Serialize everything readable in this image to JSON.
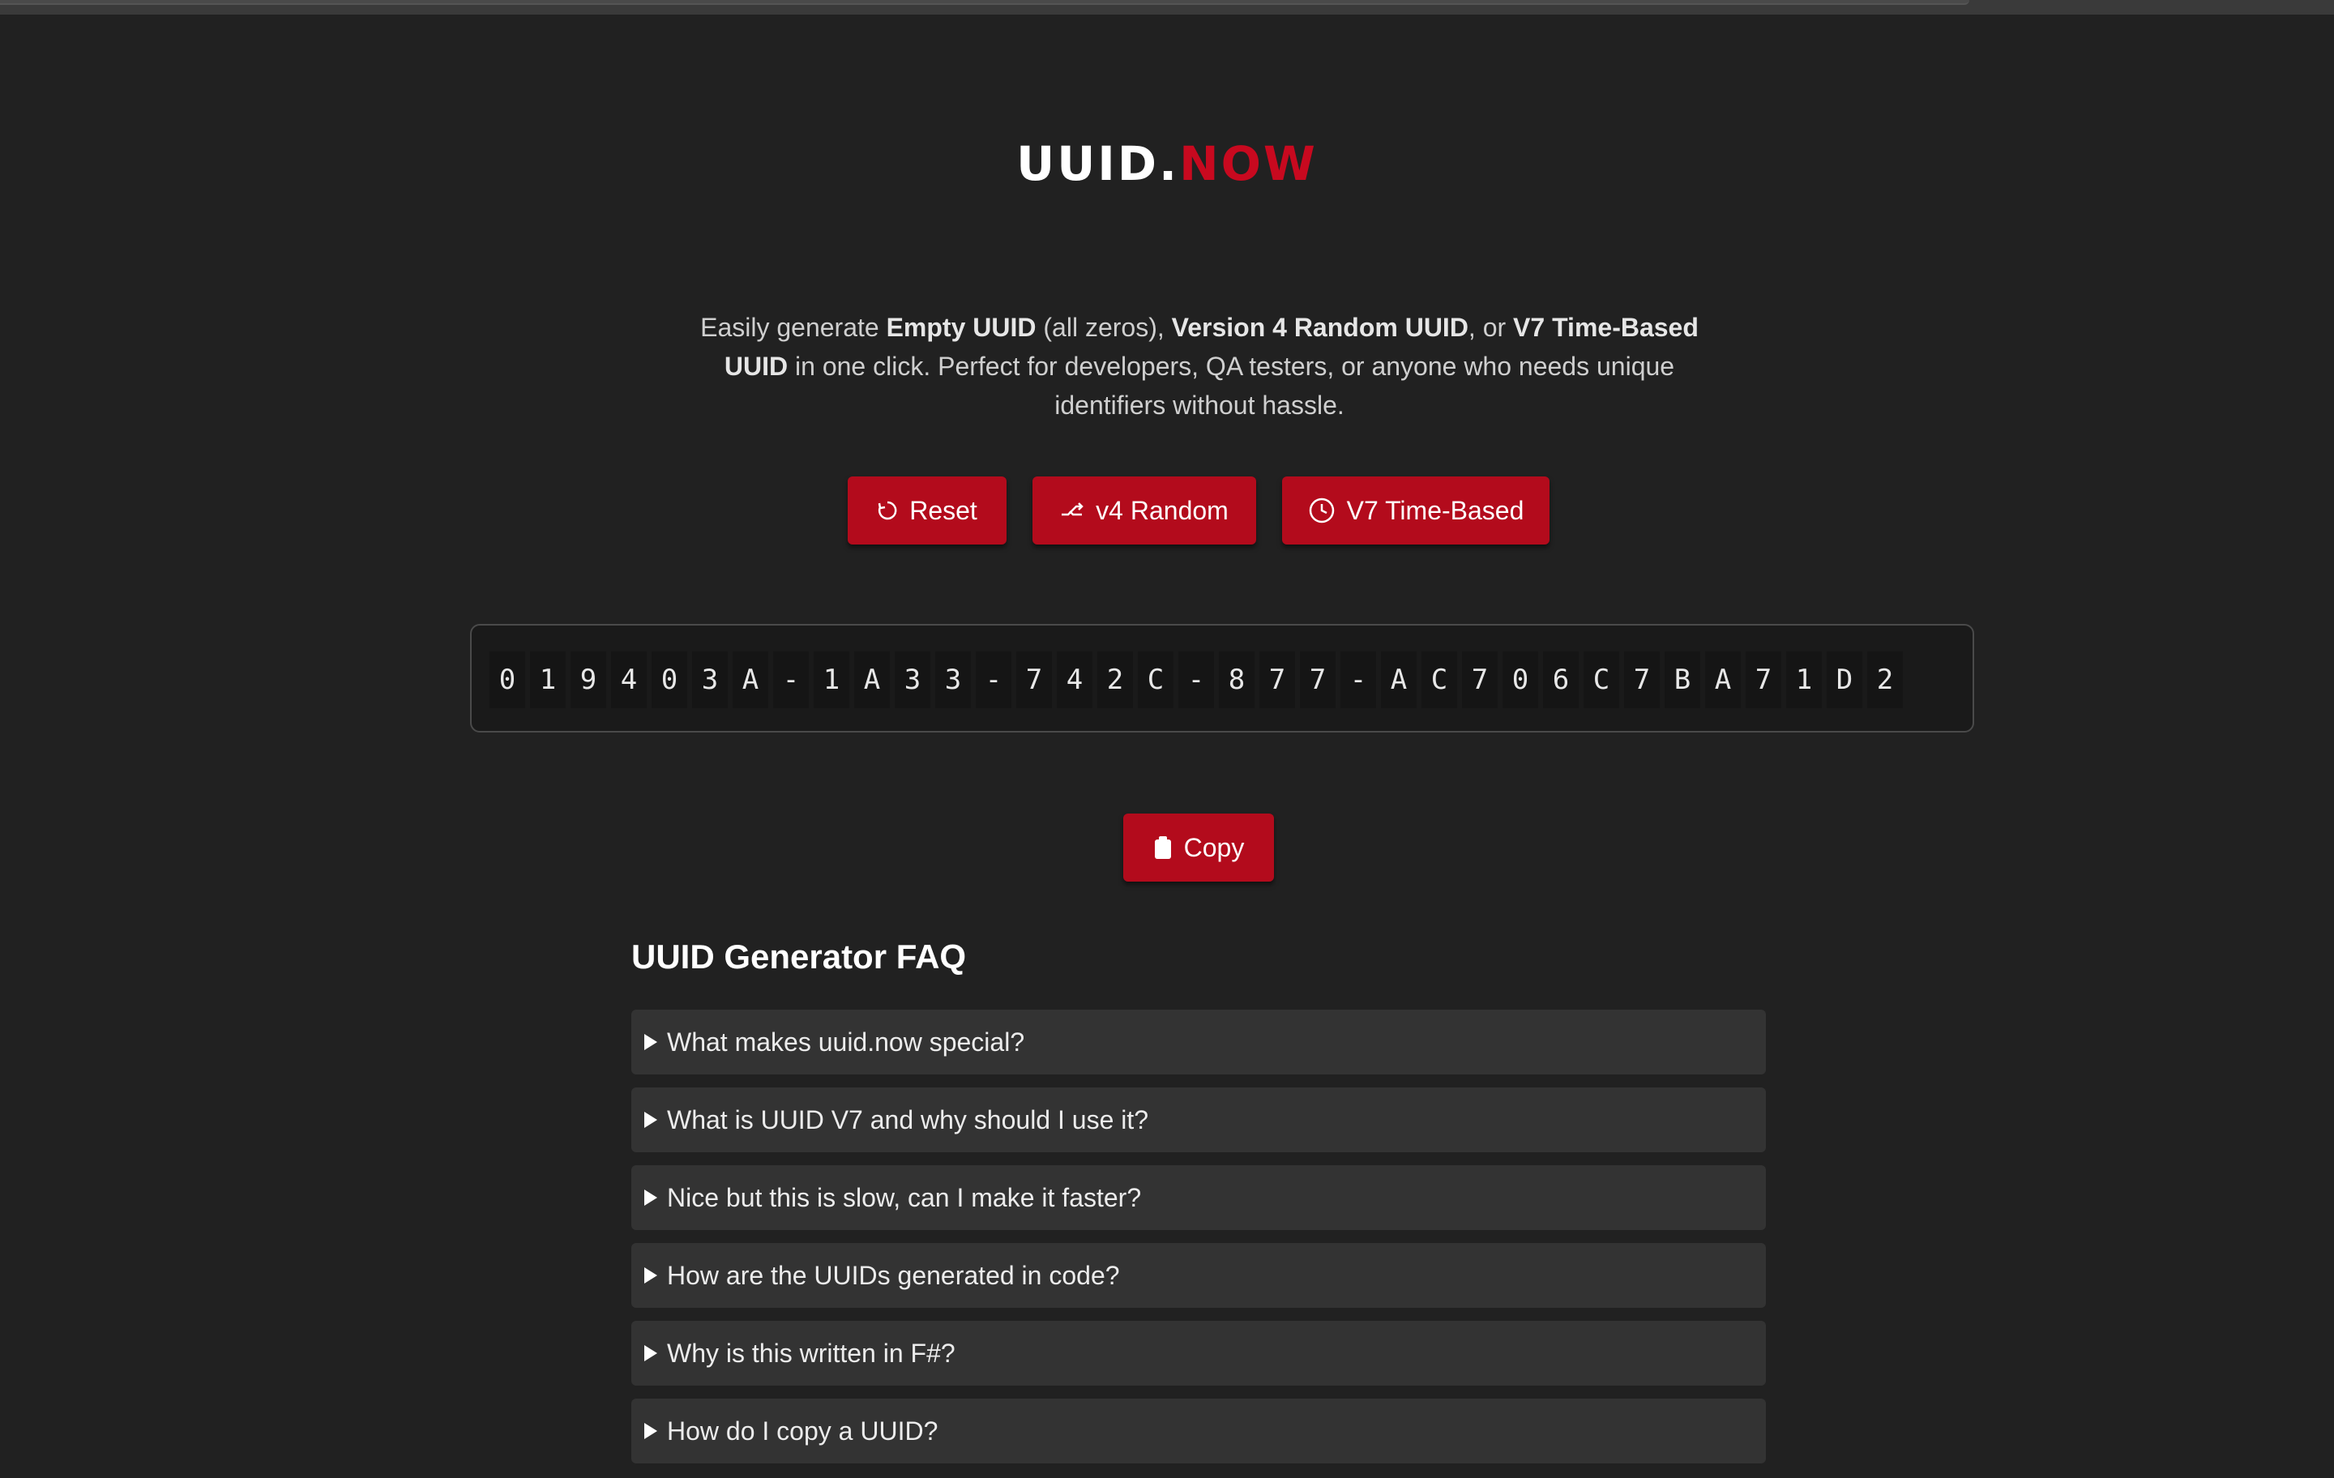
{
  "logo": {
    "part1": "UUID.",
    "part2": "NOW"
  },
  "intro": {
    "t1": "Easily generate ",
    "b1": "Empty UUID",
    "t2": " (all zeros), ",
    "b2": "Version 4 Random UUID",
    "t3": ", or ",
    "b3": "V7 Time-Based UUID",
    "t4": " in one click. Perfect for developers, QA testers, or anyone who needs unique identifiers without hassle."
  },
  "buttons": {
    "reset": "Reset",
    "v4": "v4 Random",
    "v7": "V7 Time-Based",
    "copy": "Copy"
  },
  "uuid": "019403A-1A33-742C-877-AC706C7BA71D2",
  "faq": {
    "title": "UUID Generator FAQ",
    "items": [
      "What makes uuid.now special?",
      "What is UUID V7 and why should I use it?",
      "Nice but this is slow, can I make it faster?",
      "How are the UUIDs generated in code?",
      "Why is this written in F#?",
      "How do I copy a UUID?"
    ]
  },
  "colors": {
    "accent": "#b30b1c",
    "background": "#212121"
  }
}
